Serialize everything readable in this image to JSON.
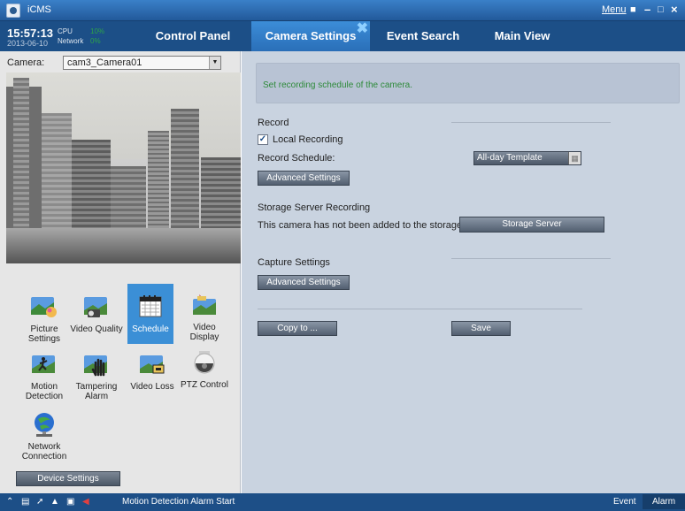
{
  "window": {
    "title": "iCMS",
    "menu_label": "Menu"
  },
  "header": {
    "time": "15:57:13",
    "date": "2013-06-10",
    "cpu_label": "CPU",
    "network_label": "Network",
    "cpu_value": "10%",
    "network_value": "0%"
  },
  "tabs": [
    {
      "label": "Control Panel",
      "active": false
    },
    {
      "label": "Camera Settings",
      "active": true
    },
    {
      "label": "Event Search",
      "active": false
    },
    {
      "label": "Main View",
      "active": false
    }
  ],
  "left": {
    "camera_label": "Camera:",
    "camera_value": "cam3_Camera01",
    "functions": [
      {
        "label": "Picture Settings",
        "icon": "picture-settings-icon"
      },
      {
        "label": "Video Quality",
        "icon": "video-quality-icon"
      },
      {
        "label": "Schedule",
        "icon": "schedule-icon",
        "selected": true
      },
      {
        "label": "Video Display",
        "icon": "video-display-icon"
      },
      {
        "label": "Motion Detection",
        "icon": "motion-detection-icon"
      },
      {
        "label": "Tampering Alarm",
        "icon": "tampering-alarm-icon"
      },
      {
        "label": "Video Loss",
        "icon": "video-loss-icon"
      },
      {
        "label": "PTZ Control",
        "icon": "ptz-control-icon"
      },
      {
        "label": "Network Connection",
        "icon": "network-connection-icon"
      }
    ],
    "device_settings": "Device Settings"
  },
  "right": {
    "info": "Set recording schedule of the camera.",
    "record_title": "Record",
    "local_recording": "Local Recording",
    "local_recording_checked": true,
    "record_schedule_label": "Record Schedule:",
    "template_value": "All-day Template",
    "advanced_settings": "Advanced Settings",
    "storage_title": "Storage Server Recording",
    "storage_text": "This camera has not been added to the storage server.",
    "storage_button": "Storage Server",
    "capture_title": "Capture Settings",
    "capture_advanced": "Advanced Settings",
    "copy_to": "Copy to ...",
    "save": "Save"
  },
  "status": {
    "message": "Motion Detection Alarm Start",
    "event": "Event",
    "alarm": "Alarm"
  },
  "colors": {
    "title_bar": "#2e6db3",
    "nav_bar": "#1c4f87",
    "active_tab": "#3a8ad4",
    "right_bg": "#c9d3e0",
    "info_text": "#2e8a3a",
    "selected_item": "#3b8fd6"
  }
}
